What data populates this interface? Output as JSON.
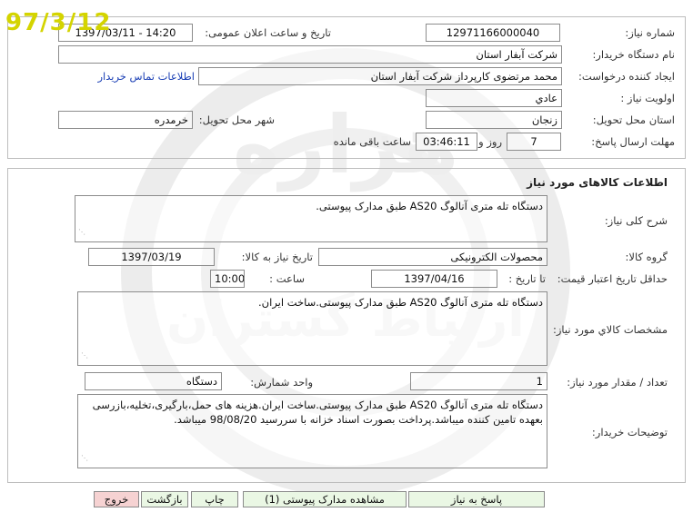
{
  "stamp": {
    "date": "97/3/12"
  },
  "watermark": {
    "text": "هزاره",
    "subtext": "ارتباط گستران"
  },
  "header": {
    "need_number": {
      "label": "شماره نیاز:",
      "value": "12971166000040"
    },
    "announce": {
      "label": "تاریخ و ساعت اعلان عمومی:",
      "value": "1397/03/11 - 14:20"
    },
    "buyer_org": {
      "label": "نام دستگاه خریدار:",
      "value": "شرکت آبفار استان"
    },
    "requester": {
      "label": "ایجاد کننده درخواست:",
      "value": "محمد مرتضوی کارپرداز  شرکت آبفار استان"
    },
    "contact_link": "اطلاعات تماس خریدار",
    "priority": {
      "label": "اولویت نیاز :",
      "value": "عادي"
    },
    "province": {
      "label": "استان محل تحویل:",
      "value": "زنجان"
    },
    "city": {
      "label": "شهر محل تحویل:",
      "value": "خرمدره"
    },
    "deadline": {
      "label": "مهلت ارسال پاسخ:",
      "days": "7",
      "days_unit": "روز و",
      "time": "03:46:11",
      "time_unit": "ساعت باقی مانده"
    }
  },
  "goods": {
    "section_title": "اطلاعات کالاهای مورد نیاز",
    "general_desc": {
      "label": "شرح کلی نیاز:",
      "value": "دستگاه تله متری آنالوگ AS20 طبق مدارک پیوستی."
    },
    "group": {
      "label": "گروه کالا:",
      "value": "محصولات الکترونیکی"
    },
    "need_date": {
      "label": "تاریخ نیاز به کالا:",
      "value": "1397/03/19"
    },
    "validity": {
      "label": "حداقل تاریخ اعتبار قیمت:",
      "to_label": "تا تاریخ :",
      "date": "1397/04/16",
      "time_label": "ساعت :",
      "time": "10:00"
    },
    "specs": {
      "label": "مشخصات کالاي مورد نیاز:",
      "value": "دستگاه تله متری آنالوگ AS20 طبق مدارک پیوستی.ساخت ایران."
    },
    "quantity": {
      "label": "تعداد / مقدار مورد نیاز:",
      "value": "1",
      "unit_label": "واحد شمارش:",
      "unit": "دستگاه"
    },
    "buyer_notes": {
      "label": "توضیحات خریدار:",
      "value": "دستگاه تله متری آنالوگ AS20 طبق مدارک پیوستی.ساخت ایران.هزینه های حمل،بارگیری،تخلیه،بازرسی بعهده تامین کننده میباشد.پرداخت بصورت اسناد خزانه با سررسید 98/08/20 میباشد."
    }
  },
  "actions": {
    "respond": "پاسخ به نیاز",
    "view_docs": "مشاهده مدارک پیوستی (1)",
    "print": "چاپ",
    "back": "بازگشت",
    "exit": "خروج"
  },
  "colors": {
    "button_green": "#eaf7e4",
    "button_red": "#f6d2d2",
    "link": "#1a3fb5",
    "stamp": "#d4d400"
  }
}
